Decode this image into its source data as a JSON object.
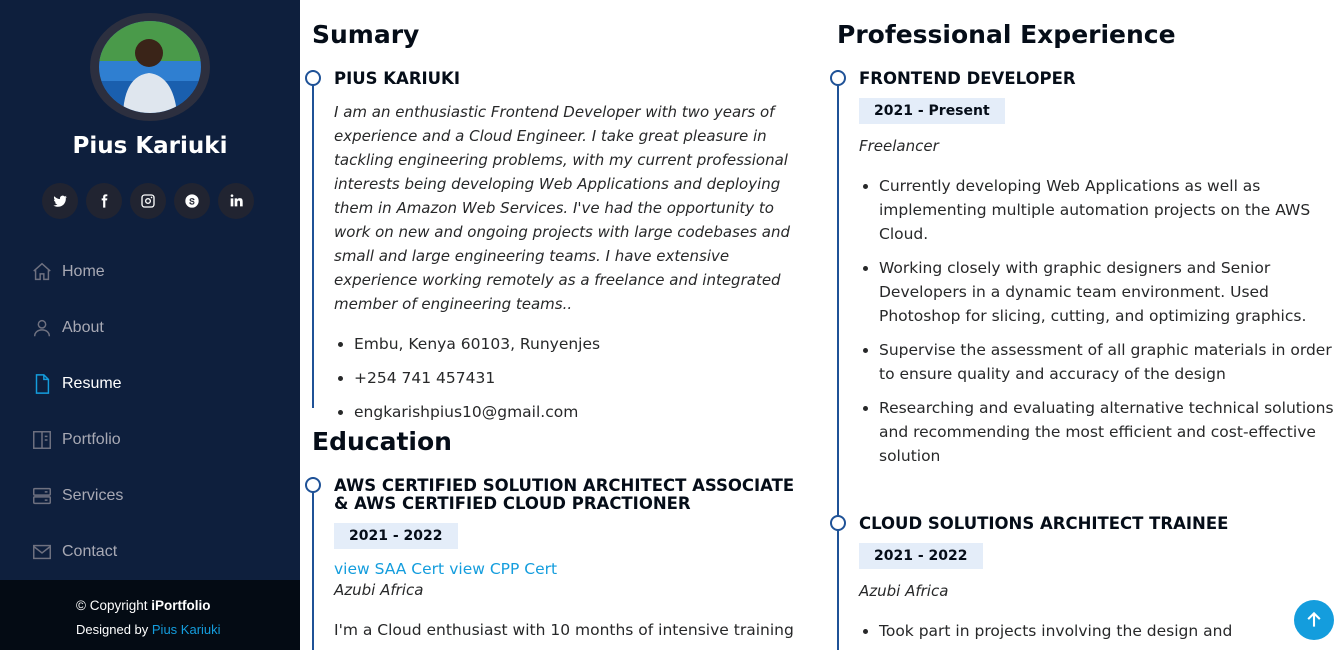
{
  "sidebar": {
    "name": "Pius Kariuki",
    "socials": [
      {
        "icon": "twitter-icon"
      },
      {
        "icon": "facebook-icon"
      },
      {
        "icon": "instagram-icon"
      },
      {
        "icon": "skype-icon"
      },
      {
        "icon": "linkedin-icon"
      }
    ],
    "nav": [
      {
        "label": "Home",
        "icon": "home-icon"
      },
      {
        "label": "About",
        "icon": "user-icon"
      },
      {
        "label": "Resume",
        "icon": "file-icon",
        "active": true
      },
      {
        "label": "Portfolio",
        "icon": "book-icon"
      },
      {
        "label": "Services",
        "icon": "server-icon"
      },
      {
        "label": "Contact",
        "icon": "envelope-icon"
      }
    ],
    "footer": {
      "copyright_prefix": "© Copyright ",
      "brand": "iPortfolio",
      "designed_prefix": "Designed by ",
      "designer": "Pius Kariuki"
    }
  },
  "summary": {
    "heading": "Sumary",
    "name": "PIUS KARIUKI",
    "text": "I am an enthusiastic Frontend Developer with two years of experience and a Cloud Engineer. I take great pleasure in tackling engineering problems, with my current professional interests being developing Web Applications and deploying them in Amazon Web Services. I've had the opportunity to work on new and ongoing projects with large codebases and small and large engineering teams. I have extensive experience working remotely as a freelance and integrated member of engineering teams..",
    "contacts": [
      "Embu, Kenya 60103, Runyenjes",
      "+254 741 457431",
      "engkarishpius10@gmail.com"
    ]
  },
  "education": {
    "heading": "Education",
    "items": [
      {
        "title": "AWS CERTIFIED SOLUTION ARCHITECT ASSOCIATE & AWS CERTIFIED CLOUD PRACTIONER",
        "period": "2021 - 2022",
        "link1": "view SAA Cert",
        "link2": "view CPP Cert",
        "org": "Azubi Africa",
        "text": "I'm a Cloud enthusiast with 10 months of intensive training"
      }
    ]
  },
  "experience": {
    "heading": "Professional Experience",
    "items": [
      {
        "title": "FRONTEND DEVELOPER",
        "period": "2021 - Present",
        "org": "Freelancer",
        "bullets": [
          "Currently developing Web Applications as well as implementing multiple automation projects on the AWS Cloud.",
          "Working closely with graphic designers and Senior Developers in a dynamic team environment. Used Photoshop for slicing, cutting, and optimizing graphics.",
          "Supervise the assessment of all graphic materials in order to ensure quality and accuracy of the design",
          "Researching and evaluating alternative technical solutions and recommending the most efficient and cost-effective solution"
        ]
      },
      {
        "title": "CLOUD SOLUTIONS ARCHITECT TRAINEE",
        "period": "2021 - 2022",
        "org": "Azubi Africa",
        "bullets": [
          "Took part in projects involving the design and"
        ]
      }
    ]
  },
  "colors": {
    "sidebar": "#0e1f3d",
    "accent": "#149ddd",
    "timeline": "#1f5297",
    "tag_bg": "#e4edf9"
  }
}
